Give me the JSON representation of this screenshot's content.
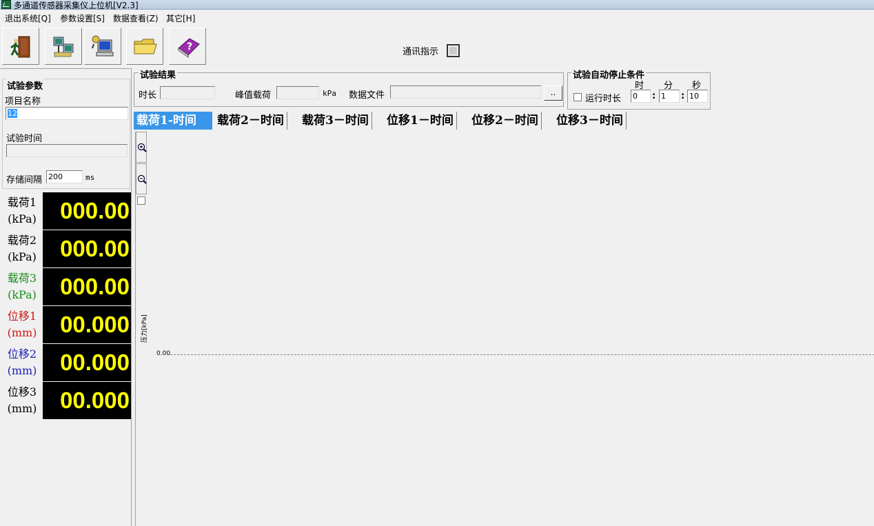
{
  "window": {
    "title": "多通道传感器采集仪上位机[V2.3]"
  },
  "menu": [
    "退出系统[Q]",
    "参数设置[S]",
    "数据查看(Z)",
    "其它[H]"
  ],
  "toolbar": {
    "buttons": [
      "exit-door-icon",
      "sensor-settings-icon",
      "computer-connect-icon",
      "open-folder-icon",
      "help-book-icon"
    ],
    "comm_label": "通讯指示"
  },
  "params": {
    "group_title": "试验参数",
    "project_label": "项目名称",
    "project_value": "12",
    "time_label": "试验时间",
    "time_value": "",
    "interval_label": "存储间隔",
    "interval_value": "200",
    "interval_unit": "ms"
  },
  "meters": [
    {
      "name": "载荷1",
      "unit": "(kPa)",
      "value": "000.00",
      "color": "#000000"
    },
    {
      "name": "载荷2",
      "unit": "(kPa)",
      "value": "000.00",
      "color": "#000000"
    },
    {
      "name": "载荷3",
      "unit": "(kPa)",
      "value": "000.00",
      "color": "#1a8a1a"
    },
    {
      "name": "位移1",
      "unit": "(mm)",
      "value": "00.000",
      "color": "#d01818"
    },
    {
      "name": "位移2",
      "unit": "(mm)",
      "value": "00.000",
      "color": "#2020b0"
    },
    {
      "name": "位移3",
      "unit": "(mm)",
      "value": "00.000",
      "color": "#000000"
    }
  ],
  "results": {
    "group_title": "试验结果",
    "duration_label": "时长",
    "duration_value": "",
    "peak_label": "峰值载荷",
    "peak_value": "",
    "peak_unit": "kPa",
    "file_label": "数据文件",
    "file_value": "",
    "browse_label": ".."
  },
  "auto_stop": {
    "group_title": "试验自动停止条件",
    "hour_label": "时",
    "min_label": "分",
    "sec_label": "秒",
    "run_label": "运行时长",
    "run_checked": false,
    "hour_value": "0",
    "min_value": "1",
    "sec_value": "10",
    "sep": ":"
  },
  "tabs": [
    "载荷1-时间",
    "载荷2－时间",
    "载荷3－时间",
    "位移1－时间",
    "位移2－时间",
    "位移3－时间"
  ],
  "active_tab": 0,
  "chart_data": {
    "type": "line",
    "ylabel": "压力[kPa]",
    "y_ticks": [
      "0.00"
    ],
    "series": [],
    "grid": false
  }
}
